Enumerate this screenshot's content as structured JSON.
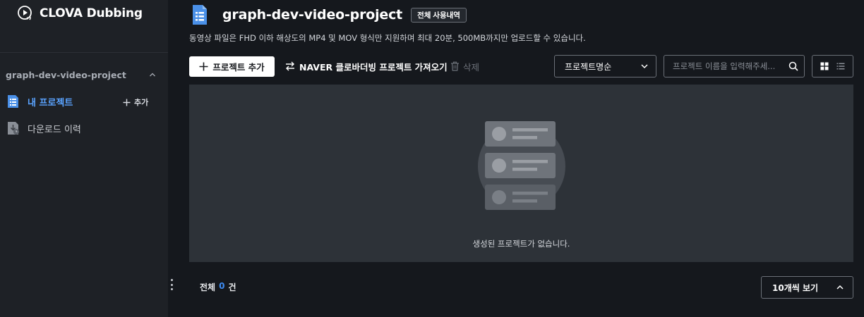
{
  "sidebar": {
    "brand": "CLOVA Dubbing",
    "project_header": "graph-dev-video-project",
    "items": [
      {
        "label": "내 프로젝트",
        "icon": "document-list-icon",
        "active": true
      },
      {
        "label": "다운로드 이력",
        "icon": "download-history-icon",
        "active": false
      }
    ],
    "add_label": "추가"
  },
  "header": {
    "title": "graph-dev-video-project",
    "usage_button": "전체 사용내역",
    "notice": "동영상 파일은 FHD 이하 해상도의 MP4 및 MOV 형식만 지원하며 최대 20분, 500MB까지만 업로드할 수 있습니다."
  },
  "toolbar": {
    "add_project": "프로젝트 추가",
    "import_naver": "NAVER 클로바더빙 프로젝트 가져오기",
    "delete": "삭제",
    "sort_value": "프로젝트명순",
    "search_placeholder": "프로젝트 이름을 입력해주세...",
    "view_modes": [
      "grid-view-icon",
      "list-view-icon"
    ]
  },
  "content": {
    "empty_message": "생성된 프로젝트가 없습니다."
  },
  "footer": {
    "total_prefix": "전체",
    "total_count": "0",
    "total_suffix": "건",
    "per_page": "10개씩 보기"
  },
  "colors": {
    "accent": "#5aa3ff",
    "count": "#3e8df5",
    "background": "#15181d",
    "sidebar": "#1e2126",
    "panel": "#2d3238"
  }
}
